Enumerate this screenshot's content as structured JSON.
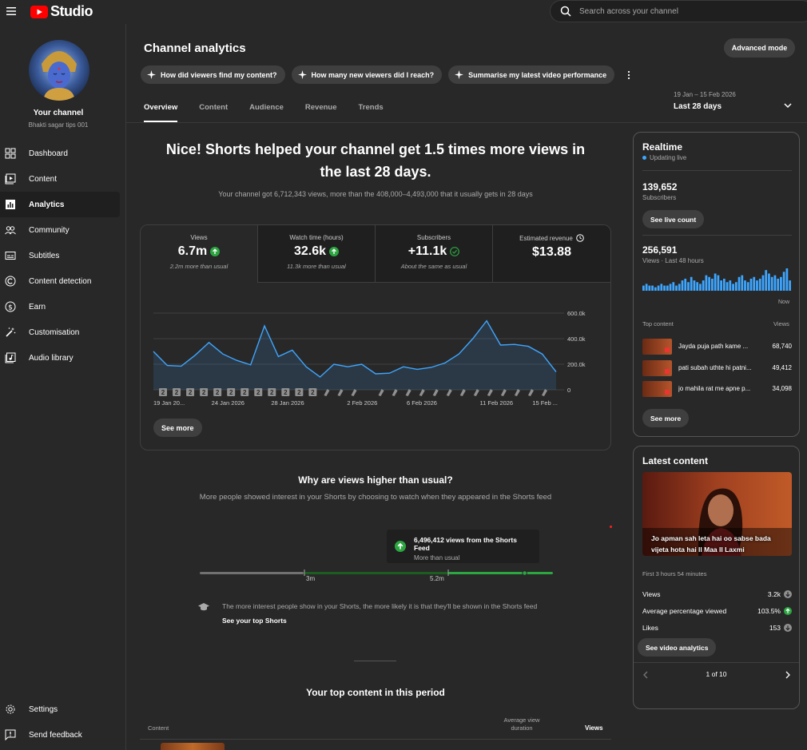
{
  "app": {
    "logo_text": "Studio",
    "brand_color": "#ff0000"
  },
  "search": {
    "placeholder": "Search across your channel"
  },
  "sidebar": {
    "channel_title": "Your channel",
    "channel_name": "Bhakti sagar tips 001",
    "items": [
      {
        "label": "Dashboard",
        "icon": "dashboard-icon"
      },
      {
        "label": "Content",
        "icon": "content-icon"
      },
      {
        "label": "Analytics",
        "icon": "analytics-icon",
        "active": true
      },
      {
        "label": "Community",
        "icon": "community-icon"
      },
      {
        "label": "Subtitles",
        "icon": "subtitles-icon"
      },
      {
        "label": "Content detection",
        "icon": "copyright-icon"
      },
      {
        "label": "Earn",
        "icon": "dollar-icon"
      },
      {
        "label": "Customisation",
        "icon": "magic-wand-icon"
      },
      {
        "label": "Audio library",
        "icon": "music-icon"
      }
    ],
    "bottom_items": [
      {
        "label": "Settings",
        "icon": "gear-icon"
      },
      {
        "label": "Send feedback",
        "icon": "feedback-icon"
      }
    ]
  },
  "header": {
    "title": "Channel analytics",
    "advanced_mode": "Advanced mode",
    "chips": [
      "How did viewers find my content?",
      "How many new viewers did I reach?",
      "Summarise my latest video performance"
    ],
    "tabs": [
      "Overview",
      "Content",
      "Audience",
      "Revenue",
      "Trends"
    ],
    "active_tab": "Overview",
    "date_range": "19 Jan – 15 Feb 2026",
    "date_label": "Last 28 days"
  },
  "overview": {
    "headline": "Nice! Shorts helped your channel get 1.5 times more views in the last 28 days.",
    "subline": "Your channel got 6,712,343 views, more than the 408,000–4,493,000 that it usually gets in 28 days",
    "metrics": [
      {
        "label": "Views",
        "value": "6.7m",
        "note": "2.2m more than usual",
        "status": "up"
      },
      {
        "label": "Watch time (hours)",
        "value": "32.6k",
        "note": "11.3k more than usual",
        "status": "up"
      },
      {
        "label": "Subscribers",
        "value": "+11.1k",
        "note": "About the same as usual",
        "status": "same"
      },
      {
        "label": "Estimated revenue",
        "value": "$13.88",
        "note": "",
        "status": "info"
      }
    ],
    "see_more": "See more"
  },
  "chart_data": {
    "type": "area",
    "ylim": [
      0,
      600000
    ],
    "yticks": [
      "0",
      "200.0k",
      "400.0k",
      "600.0k"
    ],
    "ytick_values": [
      0,
      200000,
      400000,
      600000
    ],
    "x": [
      "19 Jan 2026",
      "20 Jan",
      "21 Jan",
      "22 Jan",
      "23 Jan",
      "24 Jan",
      "25 Jan",
      "26 Jan",
      "27 Jan",
      "28 Jan",
      "29 Jan",
      "30 Jan",
      "31 Jan",
      "1 Feb",
      "2 Feb",
      "3 Feb",
      "4 Feb",
      "5 Feb",
      "6 Feb",
      "7 Feb",
      "8 Feb",
      "9 Feb",
      "10 Feb",
      "11 Feb",
      "12 Feb",
      "13 Feb",
      "14 Feb",
      "15 Feb 2026"
    ],
    "xtick_labels": [
      "19 Jan 20...",
      "24 Jan 2026",
      "28 Jan 2026",
      "2 Feb 2026",
      "6 Feb 2026",
      "11 Feb 2026",
      "15 Feb ..."
    ],
    "xtick_index": [
      0,
      5,
      9,
      14,
      18,
      23,
      27
    ],
    "values": [
      300000,
      190000,
      185000,
      270000,
      370000,
      280000,
      230000,
      195000,
      500000,
      260000,
      310000,
      180000,
      100000,
      200000,
      180000,
      200000,
      125000,
      130000,
      180000,
      160000,
      175000,
      210000,
      280000,
      400000,
      540000,
      350000,
      355000,
      340000,
      280000,
      140000
    ],
    "markers": [
      "2",
      "2",
      "2",
      "2",
      "2",
      "2",
      "2",
      "2",
      "2",
      "2",
      "2",
      "2",
      "S",
      "S",
      "S",
      "",
      "S",
      "S",
      "S",
      "S",
      "S",
      "S",
      "S",
      "S",
      "S",
      "S",
      "S",
      "S",
      "S"
    ],
    "series_color": "#3ea6ff",
    "grid": true
  },
  "why": {
    "title": "Why are views higher than usual?",
    "description": "More people showed interest in your Shorts by choosing to watch when they appeared in the Shorts feed",
    "tooltip_title": "6,496,412 views from the Shorts Feed",
    "tooltip_sub": "More than usual",
    "range_low": "3m",
    "range_high": "5.2m",
    "current_fraction": 0.92,
    "tip": "The more interest people show in your Shorts, the more likely it is that they'll be shown in the Shorts feed",
    "tip_link": "See your top Shorts"
  },
  "top_content": {
    "title": "Your top content in this period",
    "col_content": "Content",
    "col_avg": "Average view duration",
    "col_views": "Views"
  },
  "realtime": {
    "title": "Realtime",
    "live": "Updating live",
    "subscribers": "139,652",
    "subscribers_label": "Subscribers",
    "see_live": "See live count",
    "views": "256,591",
    "views_label": "Views · Last 48 hours",
    "now": "Now",
    "bars": [
      3,
      4,
      3,
      3,
      2,
      3,
      4,
      3,
      3,
      4,
      5,
      3,
      4,
      6,
      7,
      5,
      8,
      6,
      5,
      4,
      6,
      9,
      8,
      7,
      10,
      9,
      6,
      7,
      5,
      6,
      4,
      5,
      8,
      9,
      6,
      5,
      7,
      8,
      6,
      7,
      9,
      12,
      10,
      8,
      9,
      7,
      8,
      11,
      13,
      6
    ],
    "top_content_label": "Top content",
    "views_header": "Views",
    "items": [
      {
        "title": "Jayda puja path kame ...",
        "views": "68,740"
      },
      {
        "title": "pati subah uthte hi patni...",
        "views": "49,412"
      },
      {
        "title": "jo mahila rat me apne p...",
        "views": "34,098"
      }
    ],
    "see_more": "See more"
  },
  "latest": {
    "title": "Latest content",
    "video_title": "Jo apman sah leta hai oo sabse bada vijeta hota hai ll Maa ll Laxmi #viralvideo...",
    "first_label": "First 3 hours 54 minutes",
    "rows": [
      {
        "label": "Views",
        "value": "3.2k",
        "trend": "down"
      },
      {
        "label": "Average percentage viewed",
        "value": "103.5%",
        "trend": "up"
      },
      {
        "label": "Likes",
        "value": "153",
        "trend": "down"
      }
    ],
    "analytics_btn": "See video analytics",
    "pager": "1 of 10"
  }
}
